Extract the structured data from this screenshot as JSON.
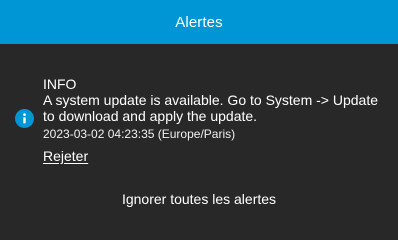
{
  "header": {
    "title": "Alertes"
  },
  "alert": {
    "icon": "info-icon",
    "level": "INFO",
    "message": "A system update is available. Go to System -> Update to download and apply the update.",
    "timestamp": "2023-03-02 04:23:35 (Europe/Paris)",
    "dismiss_label": "Rejeter"
  },
  "footer": {
    "dismiss_all_label": "Ignorer toutes les alertes"
  },
  "colors": {
    "accent": "#0095d5",
    "background": "#282828",
    "text": "#ffffff"
  }
}
